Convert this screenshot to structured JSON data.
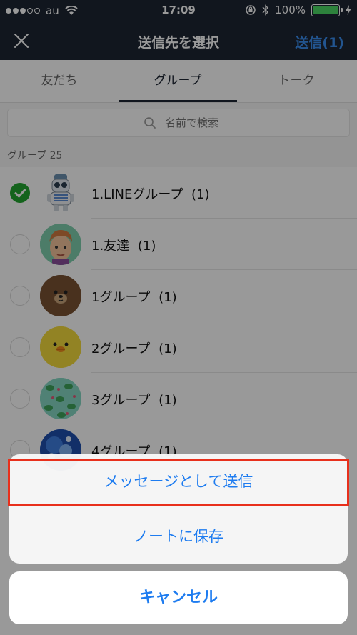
{
  "status": {
    "carrier": "au",
    "time": "17:09",
    "battery": "100%",
    "battery_level": 1.0
  },
  "nav": {
    "title": "送信先を選択",
    "send_label": "送信(1)"
  },
  "tabs": [
    {
      "label": "友だち"
    },
    {
      "label": "グループ"
    },
    {
      "label": "トーク"
    }
  ],
  "search": {
    "placeholder": "名前で検索"
  },
  "section": {
    "label": "グループ 25"
  },
  "rows": [
    {
      "name": "1.LINEグループ",
      "count": "(1)",
      "checked": true,
      "icon": "robot-avatar"
    },
    {
      "name": "1.友達",
      "count": "(1)",
      "checked": false,
      "icon": "man-avatar"
    },
    {
      "name": "1グループ",
      "count": "(1)",
      "checked": false,
      "icon": "bear-avatar"
    },
    {
      "name": "2グループ",
      "count": "(1)",
      "checked": false,
      "icon": "chick-avatar"
    },
    {
      "name": "3グループ",
      "count": "(1)",
      "checked": false,
      "icon": "frog-pattern-avatar"
    },
    {
      "name": "4グループ",
      "count": "(1)",
      "checked": false,
      "icon": "blue-bubbles-avatar"
    }
  ],
  "sheet": {
    "option1": "メッセージとして送信",
    "option2": "ノートに保存",
    "cancel": "キャンセル"
  },
  "colors": {
    "nav_bg": "#1d2533",
    "accent_blue": "#1e7cf0",
    "check_green": "#22a52f",
    "highlight_red": "#e8301c"
  }
}
